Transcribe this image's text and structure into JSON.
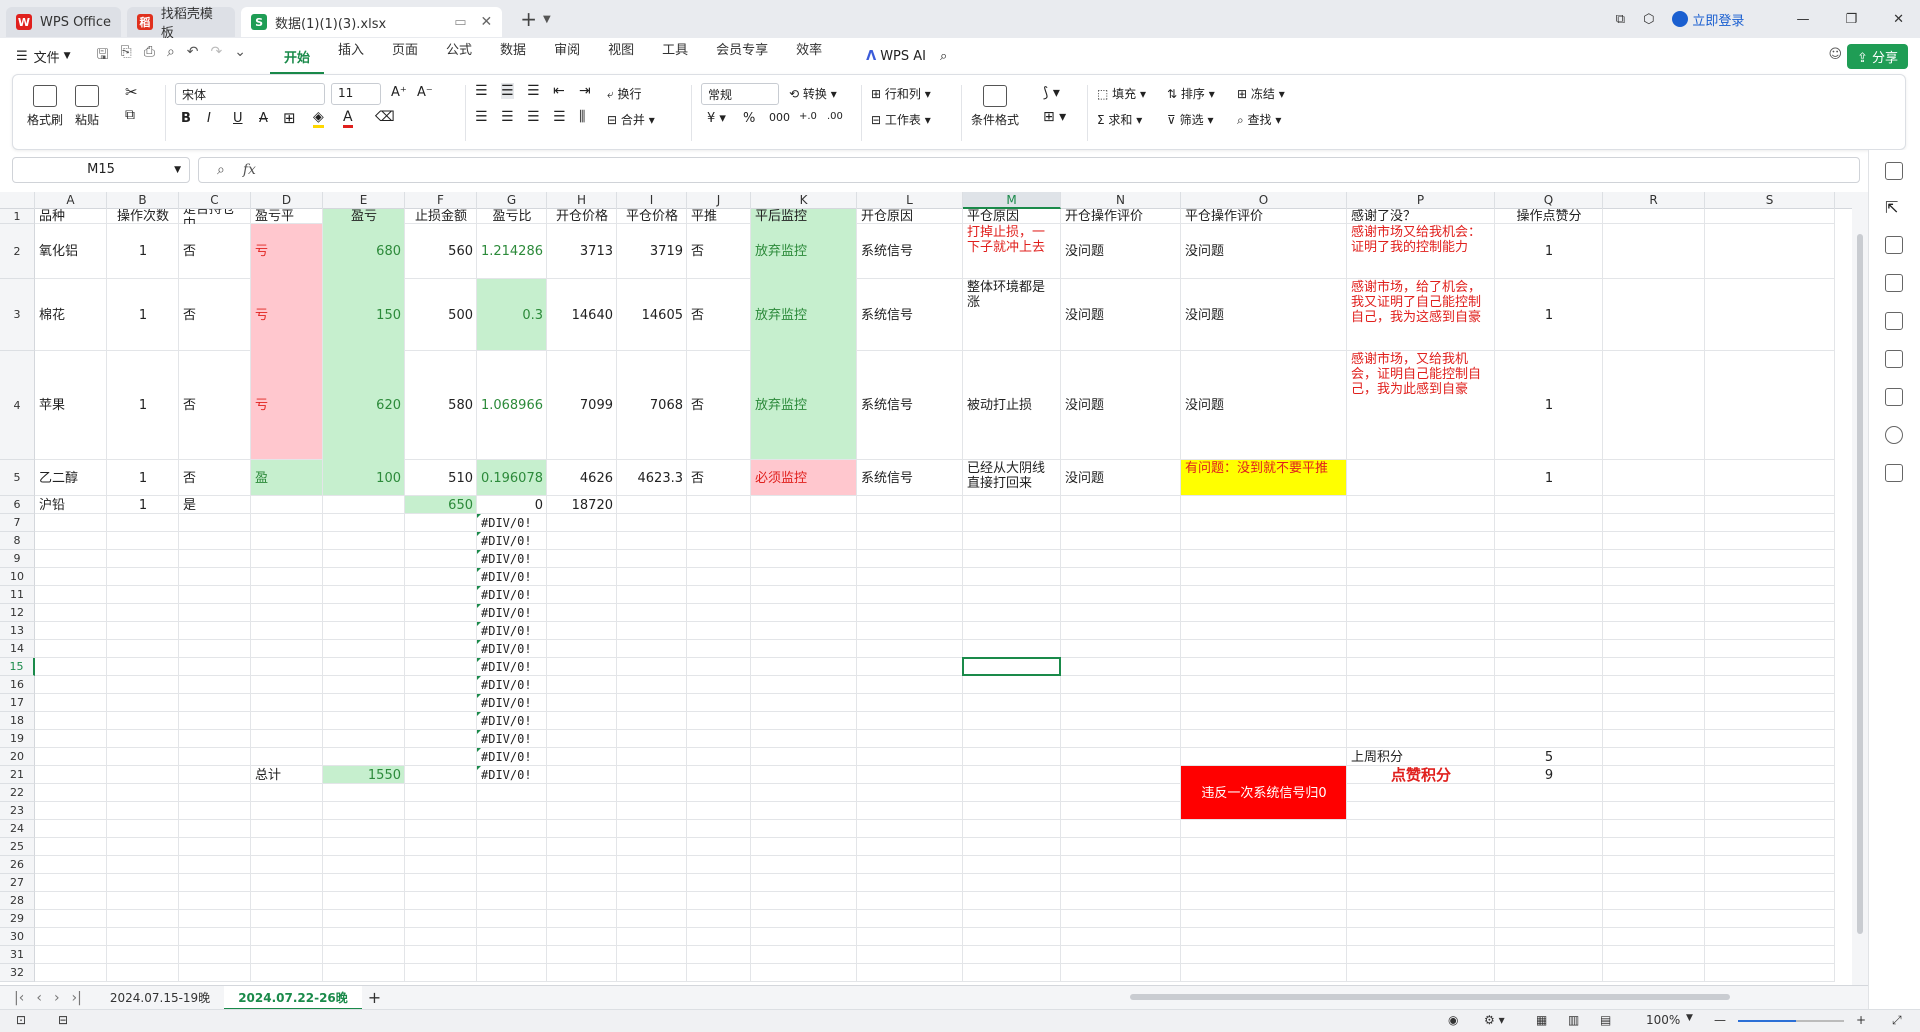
{
  "titlebar": {
    "tabs": [
      {
        "label": "WPS Office",
        "icon": "wps-logo-icon"
      },
      {
        "label": "找稻壳模板",
        "icon": "docer-logo-icon"
      },
      {
        "label": "数据(1)(1)(3).xlsx",
        "icon": "spreadsheet-s-icon"
      }
    ],
    "login_label": "立即登录"
  },
  "menubar": {
    "file_label": "文件",
    "items": [
      "开始",
      "插入",
      "页面",
      "公式",
      "数据",
      "审阅",
      "视图",
      "工具",
      "会员专享",
      "效率"
    ],
    "active_item": "开始",
    "ai_label": "WPS AI",
    "share_label": "分享"
  },
  "ribbon": {
    "format_painter": "格式刷",
    "paste": "粘贴",
    "font_name": "宋体",
    "font_size": "11",
    "wrap": "换行",
    "merge": "合并",
    "number_format": "常规",
    "convert": "转换",
    "rows_cols": "行和列",
    "worksheet": "工作表",
    "cond_format": "条件格式",
    "fill": "填充",
    "sort": "排序",
    "freeze": "冻结",
    "sum": "求和",
    "filter": "筛选",
    "find": "查找"
  },
  "formula_bar": {
    "cell_ref": "M15",
    "fx": "fx",
    "value": ""
  },
  "columns": [
    "A",
    "B",
    "C",
    "D",
    "E",
    "F",
    "G",
    "H",
    "I",
    "J",
    "K",
    "L",
    "M",
    "N",
    "O",
    "P",
    "Q",
    "R",
    "S"
  ],
  "selected_col": "M",
  "selected_row": 15,
  "rows": [
    1,
    2,
    3,
    4,
    5,
    6,
    7,
    8,
    9,
    10,
    11,
    12,
    13,
    14,
    15,
    16,
    17,
    18,
    19,
    20,
    21,
    22,
    23,
    24,
    25,
    26,
    27,
    28,
    29,
    30,
    31,
    32
  ],
  "header_row": [
    "品种",
    "操作次数",
    "是否持仓中",
    "盈亏平",
    "盈亏",
    "止损金额",
    "盈亏比",
    "开仓价格",
    "平仓价格",
    "平推",
    "平后监控",
    "开仓原因",
    "平仓原因",
    "开仓操作评价",
    "平仓操作评价",
    "感谢了没？",
    "操作点赞分"
  ],
  "data_rows": [
    {
      "A": "氧化铝",
      "B": "1",
      "C": "否",
      "D": "亏",
      "E": "680",
      "F": "560",
      "G": "1.214286",
      "H": "3713",
      "I": "3719",
      "J": "否",
      "K": "放弃监控",
      "L": "系统信号",
      "M": "打掉止损，一下子就冲上去",
      "N": "没问题",
      "O": "没问题",
      "P": "感谢市场又给我机会：证明了我的控制能力",
      "Q": "1"
    },
    {
      "A": "棉花",
      "B": "1",
      "C": "否",
      "D": "亏",
      "E": "150",
      "F": "500",
      "G": "0.3",
      "H": "14640",
      "I": "14605",
      "J": "否",
      "K": "放弃监控",
      "L": "系统信号",
      "M": "整体环境都是涨",
      "N": "没问题",
      "O": "没问题",
      "P": "感谢市场，给了机会，我又证明了自己能控制自己，我为这感到自豪",
      "Q": "1"
    },
    {
      "A": "苹果",
      "B": "1",
      "C": "否",
      "D": "亏",
      "E": "620",
      "F": "580",
      "G": "1.068966",
      "H": "7099",
      "I": "7068",
      "J": "否",
      "K": "放弃监控",
      "L": "系统信号",
      "M": "被动打止损",
      "N": "没问题",
      "O": "没问题",
      "P": "感谢市场，又给我机会，证明自己能控制自己，我为此感到自豪",
      "Q": "1"
    },
    {
      "A": "乙二醇",
      "B": "1",
      "C": "否",
      "D": "盈",
      "E": "100",
      "F": "510",
      "G": "0.196078",
      "H": "4626",
      "I": "4623.3",
      "J": "否",
      "K": "必须监控",
      "L": "系统信号",
      "M": "已经从大阴线直接打回来",
      "N": "没问题",
      "O": "有问题：没到就不要平推",
      "P": "",
      "Q": "1"
    },
    {
      "A": "沪铅",
      "B": "1",
      "C": "是",
      "D": "",
      "E": "",
      "F": "650",
      "G": "0",
      "H": "18720"
    }
  ],
  "div_error": "#DIV/0!",
  "totals": {
    "label": "总计",
    "value": "1550"
  },
  "score": {
    "last_week_label": "上周积分",
    "last_week_value": "5",
    "praise_label": "点赞积分",
    "praise_value": "9",
    "warning": "违反一次系统信号归0"
  },
  "sheets": [
    "2024.07.15-19晚",
    "2024.07.22-26晚"
  ],
  "active_sheet": "2024.07.22-26晚",
  "status": {
    "zoom": "100%"
  },
  "colors": {
    "accent": "#1a8a4a",
    "pink_fill": "#ffc7ce",
    "green_fill": "#c6efce",
    "yellow_fill": "#ffff00",
    "red_fill": "#ff0000",
    "red_text": "#e0201d"
  }
}
